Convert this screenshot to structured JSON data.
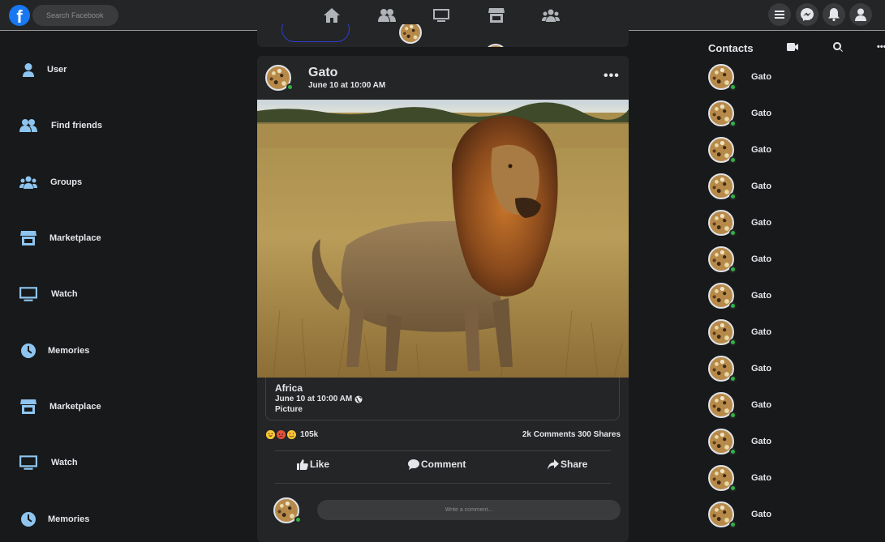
{
  "header": {
    "logo_letter": "f",
    "search_placeholder": "Search Facebook",
    "nav_icons": [
      "home-icon",
      "friends-icon",
      "watch-icon",
      "marketplace-icon",
      "groups-icon"
    ],
    "right_icons": [
      "menu-icon",
      "messenger-icon",
      "notifications-icon",
      "account-icon"
    ]
  },
  "sidebar": {
    "items": [
      {
        "label": "User",
        "icon": "user-icon"
      },
      {
        "label": "Find friends",
        "icon": "friends-icon"
      },
      {
        "label": "Groups",
        "icon": "groups-icon"
      },
      {
        "label": "Marketplace",
        "icon": "marketplace-icon"
      },
      {
        "label": "Watch",
        "icon": "watch-icon"
      },
      {
        "label": "Memories",
        "icon": "clock-icon"
      },
      {
        "label": "Marketplace",
        "icon": "marketplace-icon"
      },
      {
        "label": "Watch",
        "icon": "watch-icon"
      },
      {
        "label": "Memories",
        "icon": "clock-icon"
      }
    ]
  },
  "post": {
    "author": "Gato",
    "time": "June 10 at 10:00 AM",
    "more_label": "•••",
    "image_alt": "lion",
    "caption": {
      "title": "Africa",
      "date": "June 10 at 10:00 AM",
      "type": "Picture"
    },
    "reactions_count": "105k",
    "stats": "2k Comments 300 Shares",
    "actions": {
      "like": "Like",
      "comment": "Comment",
      "share": "Share"
    },
    "comment_placeholder": "Write a comment..."
  },
  "contacts": {
    "title": "Contacts",
    "more_label": "•••",
    "list": [
      "Gato",
      "Gato",
      "Gato",
      "Gato",
      "Gato",
      "Gato",
      "Gato",
      "Gato",
      "Gato",
      "Gato",
      "Gato",
      "Gato",
      "Gato"
    ]
  },
  "colors": {
    "background": "#18191a",
    "surface": "#242526",
    "accent": "#1877f2",
    "sidebar_icon": "#8ec5f0",
    "online": "#2fb344"
  }
}
